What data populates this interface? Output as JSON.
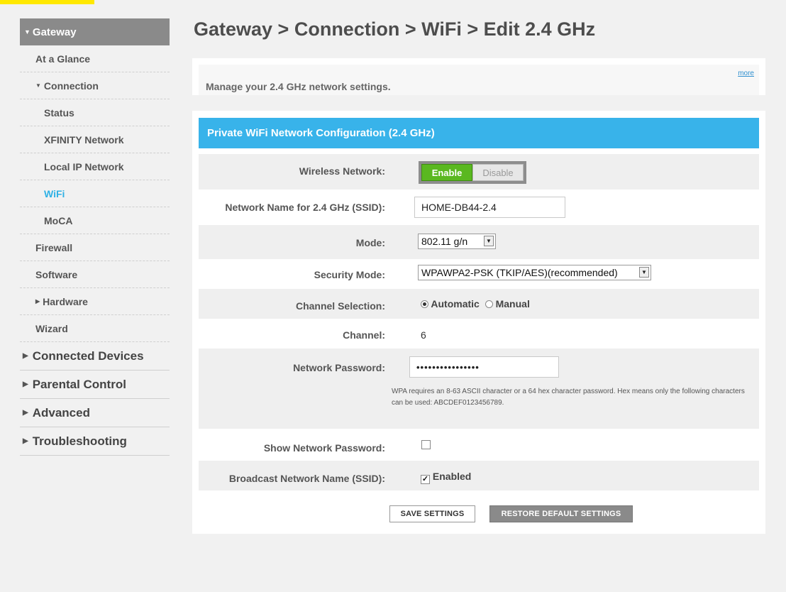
{
  "sidebar": {
    "top": "Gateway",
    "items": [
      {
        "label": "At a Glance"
      },
      {
        "label": "Connection"
      },
      {
        "label": "Status"
      },
      {
        "label": "XFINITY Network"
      },
      {
        "label": "Local IP Network"
      },
      {
        "label": "WiFi"
      },
      {
        "label": "MoCA"
      },
      {
        "label": "Firewall"
      },
      {
        "label": "Software"
      },
      {
        "label": "Hardware"
      },
      {
        "label": "Wizard"
      }
    ],
    "main": [
      {
        "label": "Connected Devices"
      },
      {
        "label": "Parental Control"
      },
      {
        "label": "Advanced"
      },
      {
        "label": "Troubleshooting"
      }
    ]
  },
  "page": {
    "title": "Gateway > Connection > WiFi > Edit 2.4 GHz",
    "description": "Manage your 2.4 GHz network settings.",
    "more": "more"
  },
  "config": {
    "header": "Private WiFi Network Configuration (2.4 GHz)",
    "wireless_label": "Wireless Network:",
    "enable": "Enable",
    "disable": "Disable",
    "ssid_label": "Network Name for 2.4 GHz (SSID):",
    "ssid_value": "HOME-DB44-2.4",
    "mode_label": "Mode:",
    "mode_value": "802.11 g/n",
    "security_label": "Security Mode:",
    "security_value": "WPAWPA2-PSK (TKIP/AES)(recommended)",
    "channel_sel_label": "Channel Selection:",
    "automatic": "Automatic",
    "manual": "Manual",
    "channel_label": "Channel:",
    "channel_value": "6",
    "password_label": "Network Password:",
    "password_value": "••••••••••••••••",
    "hint": "WPA requires an 8-63 ASCII character or a 64 hex character password. Hex means only the following characters can be used: ABCDEF0123456789.",
    "show_password_label": "Show Network Password:",
    "broadcast_label": "Broadcast Network Name (SSID):",
    "broadcast_value": "Enabled",
    "save": "SAVE SETTINGS",
    "restore": "RESTORE DEFAULT SETTINGS"
  },
  "colors": {
    "accent": "#38b3ea",
    "enable_green": "#5ab820",
    "active_link": "#2fb1e5",
    "brand_yellow": "#ffe800"
  }
}
